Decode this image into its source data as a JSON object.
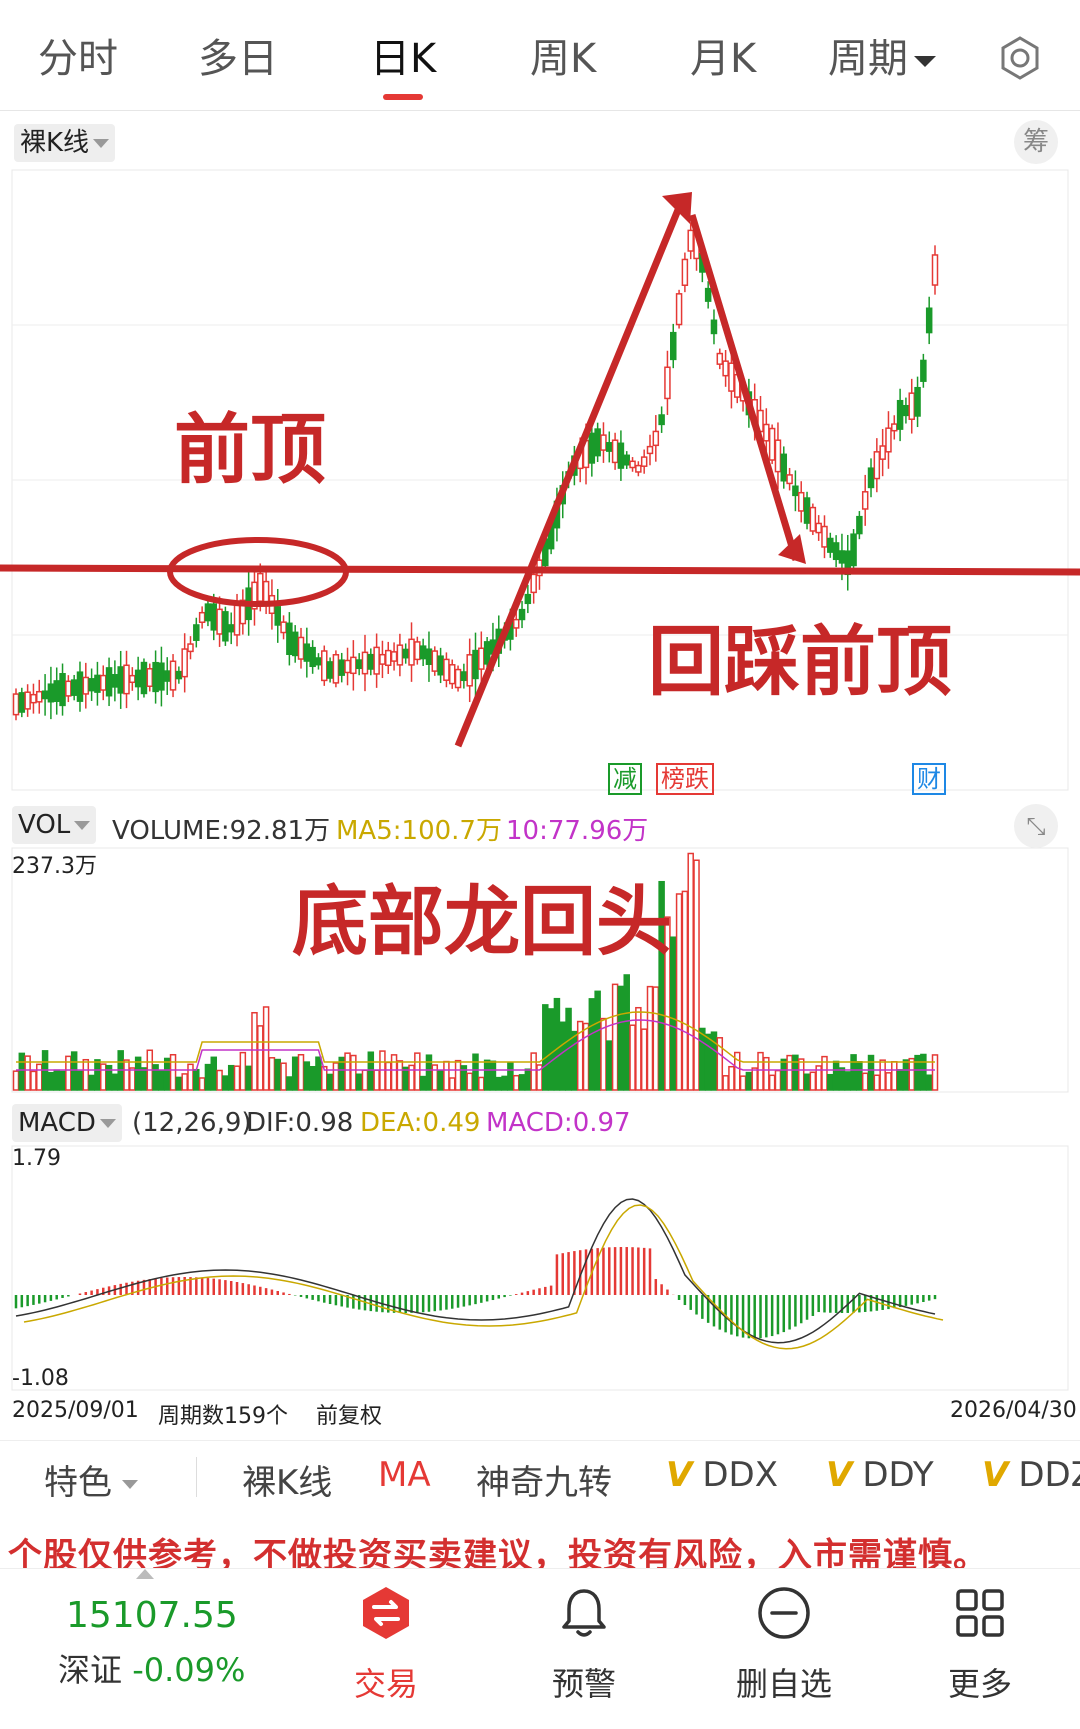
{
  "tabs": [
    {
      "label": "分时"
    },
    {
      "label": "多日"
    },
    {
      "label": "日K"
    },
    {
      "label": "周K"
    },
    {
      "label": "月K"
    },
    {
      "label": "周期"
    }
  ],
  "kline": {
    "mode_label": "裸K线",
    "chip_button": "筹",
    "event_tags": [
      "减",
      "榜跌",
      "财"
    ]
  },
  "annotations": {
    "prev_top": "前顶",
    "pullback": "回踩前顶",
    "pattern": "底部龙回头"
  },
  "volume": {
    "label": "VOL",
    "volume_text": "VOLUME:92.81万",
    "ma5_text": "MA5:100.7万",
    "ma10_text": "10:77.96万",
    "max_label": "237.3万",
    "ma5_color": "#c9a800",
    "ma10_color": "#c233c8"
  },
  "macd": {
    "label": "MACD",
    "params": "(12,26,9)",
    "dif_text": "DIF:0.98",
    "dea_text": "DEA:0.49",
    "macd_text": "MACD:0.97",
    "max_label": "1.79",
    "min_label": "-1.08"
  },
  "footer_axis": {
    "start_date": "2025/09/01",
    "period_count": "周期数159个",
    "adjust": "前复权",
    "end_date": "2026/04/30"
  },
  "indicators": [
    "特色",
    "裸K线",
    "MA",
    "神奇九转",
    "DDX",
    "DDY",
    "DDZ"
  ],
  "disclaimer": "个股仅供参考，不做投资买卖建议，投资有风险，入市需谨慎。",
  "bottom_nav": {
    "index_value": "15107.55",
    "index_name": "深证",
    "index_change": "-0.09%",
    "trade": "交易",
    "alert": "预警",
    "remove_watch": "删自选",
    "more": "更多"
  },
  "colors": {
    "up": "#e53935",
    "down": "#1a9a2a",
    "accent": "#e53935",
    "annotation": "#c62828"
  }
}
